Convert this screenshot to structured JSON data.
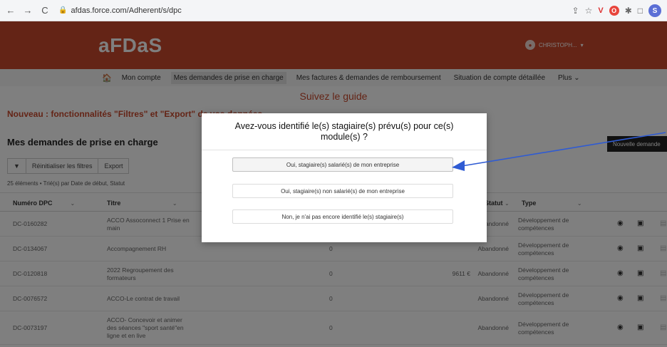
{
  "browser": {
    "url": "afdas.force.com/Adherent/s/dpc",
    "profile_initial": "S"
  },
  "header": {
    "logo": "aFDaS",
    "user": "CHRISTOPH..."
  },
  "nav": {
    "items": [
      "Mon compte",
      "Mes demandes de prise en charge",
      "Mes factures & demandes de remboursement",
      "Situation de compte détaillée",
      "Plus"
    ]
  },
  "guide": "Suivez le guide",
  "banner": "Nouveau : fonctionnalités \"Filtres\" et \"Export\" de vos données",
  "page_title": "Mes demandes de prise en charge",
  "new_button": "Nouvelle demande",
  "toolbar": {
    "reset": "Réinitialiser les filtres",
    "export": "Export"
  },
  "count_text": "25 éléments • Trié(s) par Date de début, Statut",
  "table": {
    "columns": [
      "Numéro DPC",
      "Titre",
      "Statut",
      "Type"
    ],
    "rows": [
      {
        "num": "DC-0160282",
        "title": "ACCO Assoconnect 1 Prise en main",
        "amount": "",
        "amount2": "",
        "status": "Abandonné",
        "type": "Développement de compétences"
      },
      {
        "num": "DC-0134067",
        "title": "Accompagnement RH",
        "amount": "0",
        "amount2": "",
        "status": "Abandonné",
        "type": "Développement de compétences"
      },
      {
        "num": "DC-0120818",
        "title": "2022 Regroupement des formateurs",
        "amount": "0",
        "amount2": "9611 €",
        "status": "Abandonné",
        "type": "Développement de compétences"
      },
      {
        "num": "DC-0076572",
        "title": "ACCO-Le contrat de travail",
        "amount": "0",
        "amount2": "",
        "status": "Abandonné",
        "type": "Développement de compétences"
      },
      {
        "num": "DC-0073197",
        "title": "ACCO- Concevoir et animer des séances \"sport santé\"en ligne et en live",
        "amount": "0",
        "amount2": "",
        "status": "Abandonné",
        "type": "Développement de compétences"
      }
    ]
  },
  "modal": {
    "title": "Avez-vous identifié le(s) stagiaire(s) prévu(s) pour ce(s) module(s) ?",
    "options": [
      "Oui, stagiaire(s) salarié(s) de mon entreprise",
      "Oui, stagiaire(s) non salarié(s) de mon entreprise",
      "Non, je n'ai pas encore identifié le(s) stagiaire(s)"
    ]
  },
  "colors": {
    "brand": "#c8492c",
    "annotation_arrow": "#2f5bd3"
  }
}
